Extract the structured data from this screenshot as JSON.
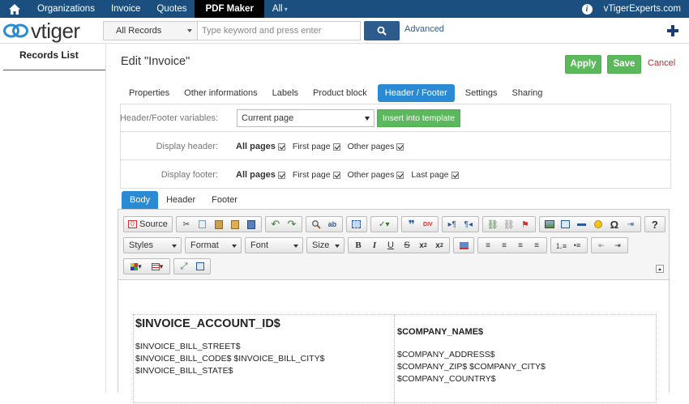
{
  "topnav": {
    "items": [
      "Organizations",
      "Invoice",
      "Quotes",
      "PDF Maker",
      "All"
    ],
    "active": "PDF Maker",
    "user": "vTigerExperts.com"
  },
  "header": {
    "logo_text": "vtiger",
    "records_select": "All Records",
    "search_placeholder": "Type keyword and press enter",
    "advanced_label": "Advanced"
  },
  "sidebar": {
    "title": "Records List"
  },
  "page": {
    "title": "Edit \"Invoice\"",
    "apply_label": "Apply",
    "save_label": "Save",
    "cancel_label": "Cancel"
  },
  "tabs": [
    {
      "label": "Properties",
      "active": false
    },
    {
      "label": "Other informations",
      "active": false
    },
    {
      "label": "Labels",
      "active": false
    },
    {
      "label": "Product block",
      "active": false
    },
    {
      "label": "Header / Footer",
      "active": true
    },
    {
      "label": "Settings",
      "active": false
    },
    {
      "label": "Sharing",
      "active": false
    }
  ],
  "settings": {
    "variables_label": "Header/Footer variables:",
    "variables_value": "Current page",
    "insert_label": "Insert into template",
    "display_header_label": "Display header:",
    "display_header": [
      "All pages",
      "First page",
      "Other pages"
    ],
    "display_footer_label": "Display footer:",
    "display_footer": [
      "All pages",
      "First page",
      "Other pages",
      "Last page"
    ]
  },
  "subtabs": [
    {
      "label": "Body",
      "active": true
    },
    {
      "label": "Header",
      "active": false
    },
    {
      "label": "Footer",
      "active": false
    }
  ],
  "editor": {
    "source_label": "Source",
    "styles_label": "Styles",
    "format_label": "Format",
    "font_label": "Font",
    "size_label": "Size"
  },
  "template": {
    "left_title": "$INVOICE_ACCOUNT_ID$",
    "left_lines": [
      "$INVOICE_BILL_STREET$",
      "$INVOICE_BILL_CODE$ $INVOICE_BILL_CITY$",
      "$INVOICE_BILL_STATE$"
    ],
    "right_title": "$COMPANY_NAME$",
    "right_lines": [
      "$COMPANY_ADDRESS$",
      "$COMPANY_ZIP$ $COMPANY_CITY$",
      "$COMPANY_COUNTRY$"
    ]
  }
}
